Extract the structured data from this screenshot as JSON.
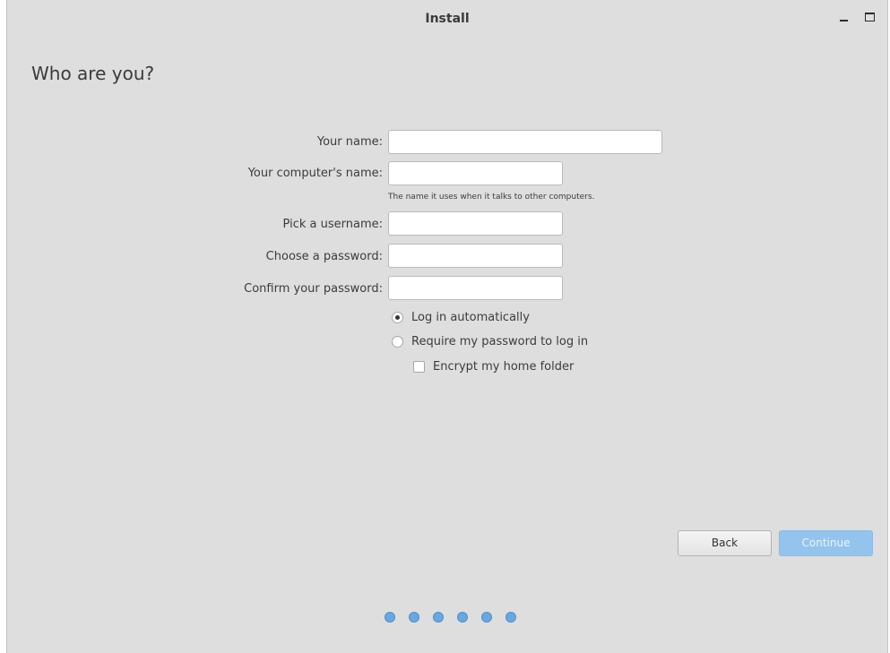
{
  "window": {
    "title": "Install"
  },
  "page": {
    "heading": "Who are you?"
  },
  "form": {
    "name_label": "Your name:",
    "name_value": "",
    "computer_label": "Your computer's name:",
    "computer_value": "",
    "computer_hint": "The name it uses when it talks to other computers.",
    "username_label": "Pick a username:",
    "username_value": "",
    "password_label": "Choose a password:",
    "password_value": "",
    "confirm_label": "Confirm your password:",
    "confirm_value": ""
  },
  "login": {
    "auto_label": "Log in automatically",
    "auto_selected": true,
    "require_label": "Require my password to log in",
    "require_selected": false,
    "encrypt_label": "Encrypt my home folder",
    "encrypt_checked": false
  },
  "buttons": {
    "back_label": "Back",
    "continue_label": "Continue"
  },
  "progress": {
    "steps": 6
  },
  "colors": {
    "window_bg": "#dedede",
    "accent": "#94c4ee",
    "dot": "#6aa7e0"
  }
}
